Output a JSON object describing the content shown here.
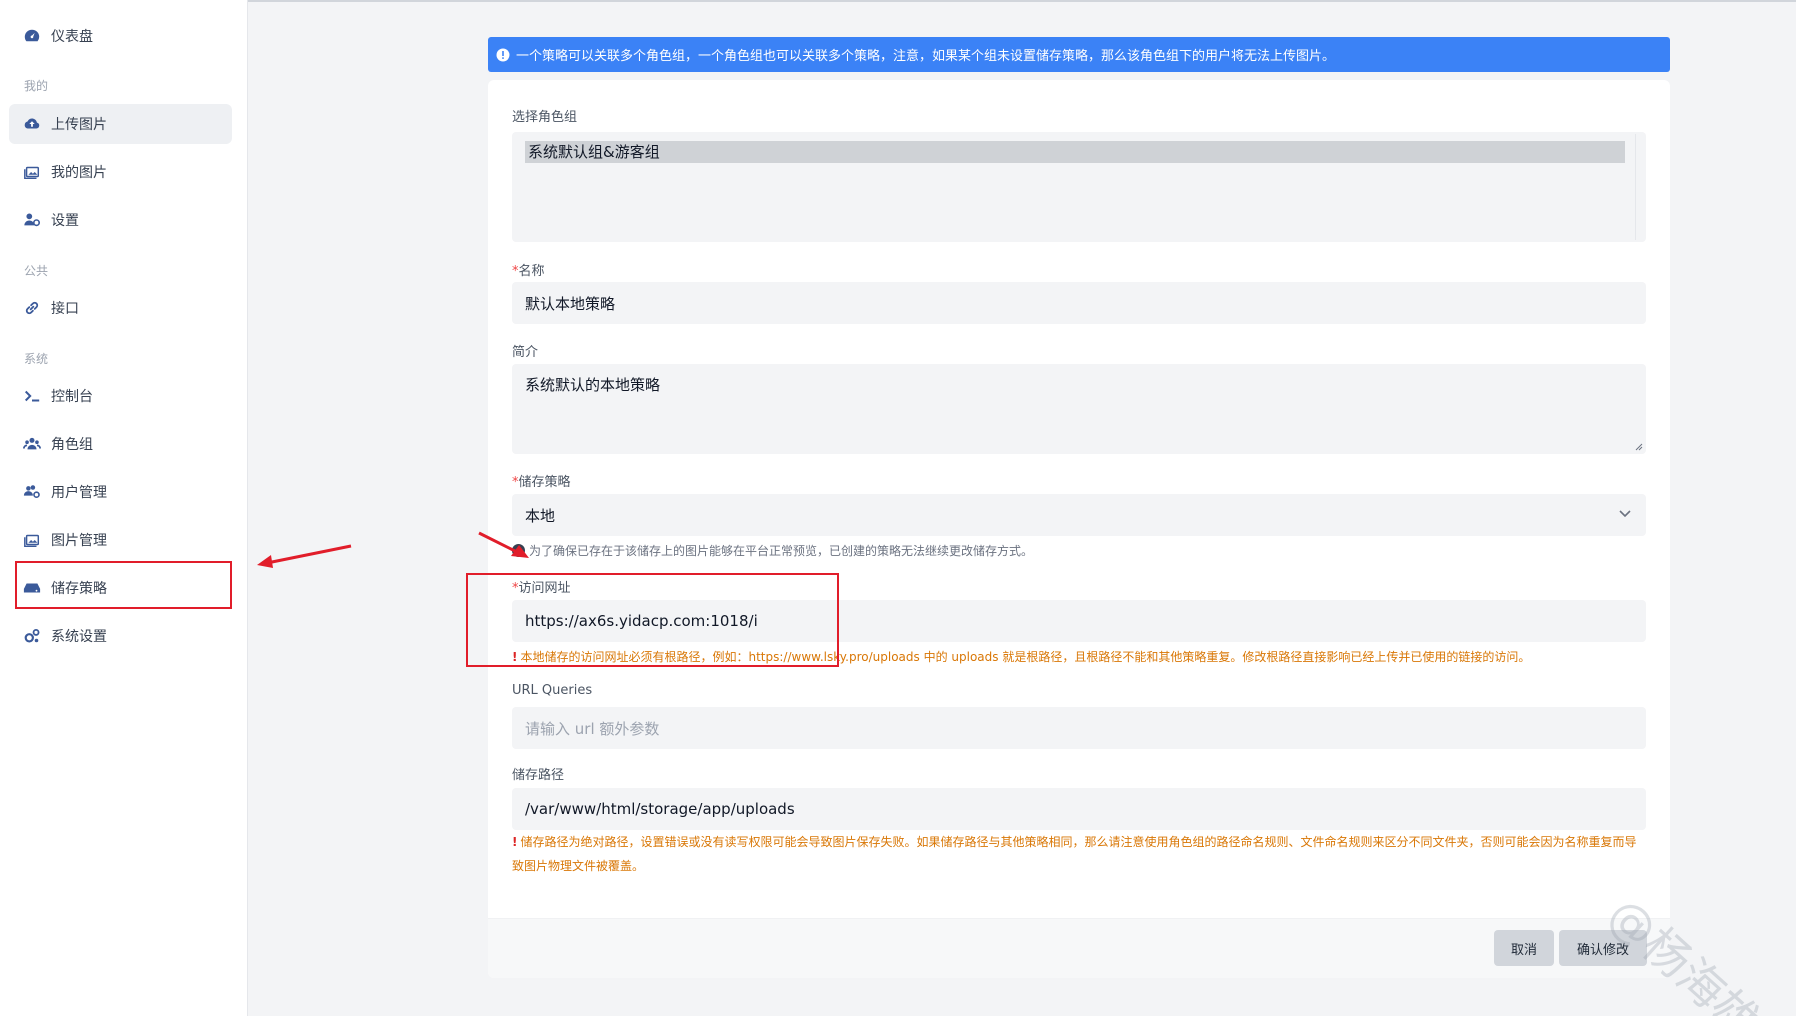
{
  "sidebar": {
    "items": [
      {
        "label": "仪表盘",
        "icon": "dashboard-icon"
      },
      {
        "label": "上传图片",
        "icon": "cloud-upload-icon"
      },
      {
        "label": "我的图片",
        "icon": "images-icon"
      },
      {
        "label": "设置",
        "icon": "user-cog-icon"
      },
      {
        "label": "接口",
        "icon": "link-icon"
      },
      {
        "label": "控制台",
        "icon": "terminal-icon"
      },
      {
        "label": "角色组",
        "icon": "users-icon"
      },
      {
        "label": "用户管理",
        "icon": "users-cog-icon"
      },
      {
        "label": "图片管理",
        "icon": "images-icon"
      },
      {
        "label": "储存策略",
        "icon": "hdd-icon"
      },
      {
        "label": "系统设置",
        "icon": "cogs-icon"
      }
    ],
    "sections": {
      "mine": "我的",
      "public": "公共",
      "system": "系统"
    },
    "active_item": "上传图片"
  },
  "alert": {
    "text": "一个策略可以关联多个角色组，一个角色组也可以关联多个策略，注意，如果某个组未设置储存策略，那么该角色组下的用户将无法上传图片。",
    "color": "#3b82f6"
  },
  "form": {
    "role_group": {
      "label": "选择角色组",
      "options": [
        "系统默认组&游客组"
      ]
    },
    "name": {
      "required_mark": "*",
      "label": "名称",
      "value": "默认本地策略"
    },
    "intro": {
      "label": "简介",
      "value": "系统默认的本地策略"
    },
    "storage": {
      "required_mark": "*",
      "label": "储存策略",
      "value": "本地",
      "hint": "为了确保已存在于该储存上的图片能够在平台正常预览，已创建的策略无法继续更改储存方式。"
    },
    "url": {
      "required_mark": "*",
      "label": "访问网址",
      "value": "https://ax6s.yidacp.com:1018/i",
      "warning": "本地储存的访问网址必须有根路径，例如：https://www.lsky.pro/uploads 中的 uploads 就是根路径，且根路径不能和其他策略重复。修改根路径直接影响已经上传并已使用的链接的访问。"
    },
    "url_queries": {
      "label": "URL Queries",
      "placeholder": "请输入 url 额外参数"
    },
    "path": {
      "label": "储存路径",
      "value": "/var/www/html/storage/app/uploads",
      "warning": "储存路径为绝对路径，设置错误或没有读写权限可能会导致图片保存失败。如果储存路径与其他策略相同，那么请注意使用角色组的路径命名规则、文件命名规则来区分不同文件夹，否则可能会因为名称重复而导致图片物理文件被覆盖。"
    }
  },
  "buttons": {
    "cancel": "取消",
    "confirm": "确认修改"
  },
  "watermark": "@杨海雄",
  "annotation_color": "#e11d2a"
}
